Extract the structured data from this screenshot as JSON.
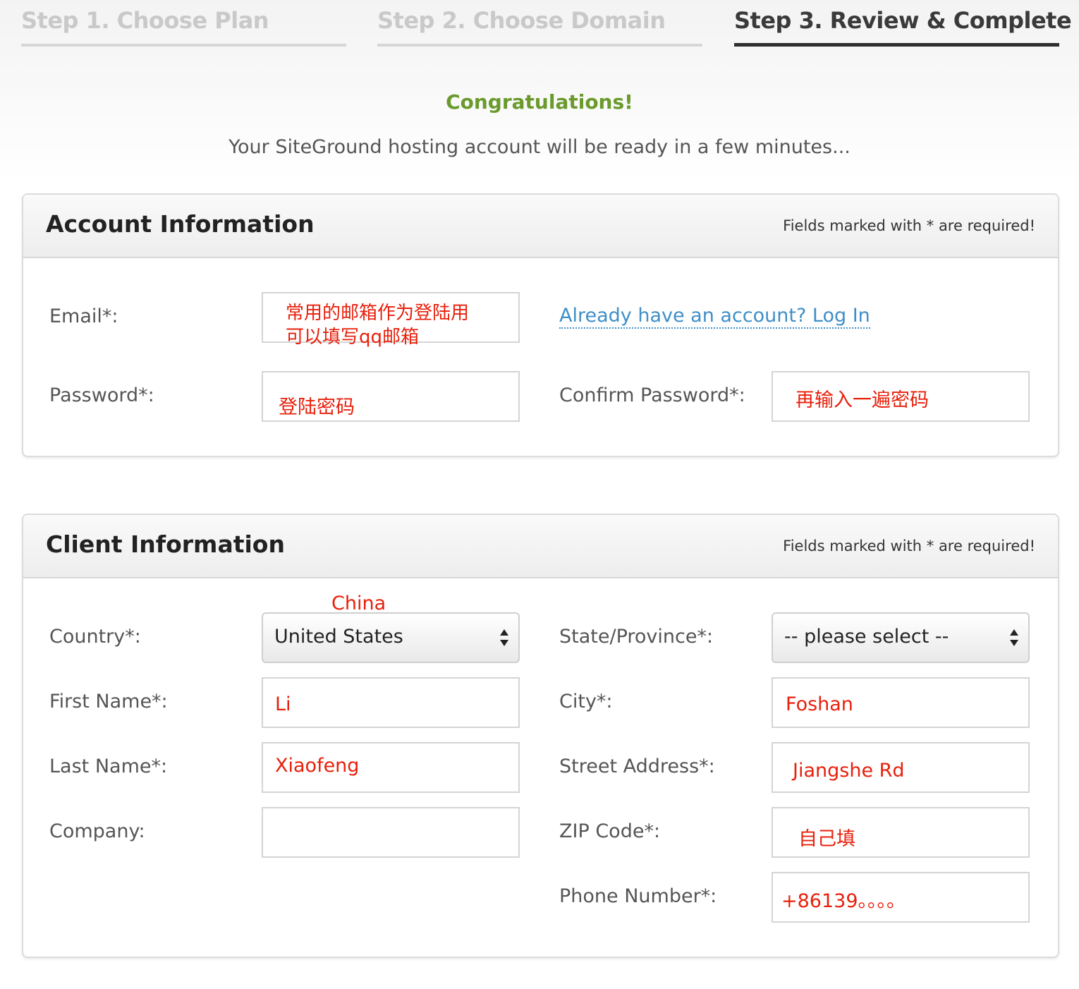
{
  "steps": [
    {
      "label": "Step 1. Choose Plan",
      "state": "inactive"
    },
    {
      "label": "Step 2. Choose Domain",
      "state": "inactive"
    },
    {
      "label": "Step 3. Review & Complete",
      "state": "active"
    }
  ],
  "congrats": "Congratulations!",
  "ready_text": "Your SiteGround hosting account will be ready in a few minutes...",
  "account": {
    "title": "Account Information",
    "note": "Fields marked with * are required!",
    "email_label": "Email*:",
    "email_annotation_line1": "常用的邮箱作为登陆用",
    "email_annotation_line2": "可以填写qq邮箱",
    "login_link": "Already have an account? Log In",
    "password_label": "Password*:",
    "password_annotation": "登陆密码",
    "confirm_label": "Confirm Password*:",
    "confirm_annotation": "再输入一遍密码"
  },
  "client": {
    "title": "Client Information",
    "note": "Fields marked with * are required!",
    "country_label": "Country*:",
    "country_value": "United States",
    "country_annotation": "China",
    "state_label": "State/Province*:",
    "state_value": "-- please select --",
    "first_name_label": "First Name*:",
    "first_name_annotation": "Li",
    "city_label": "City*:",
    "city_annotation": "Foshan",
    "last_name_label": "Last Name*:",
    "last_name_annotation": "Xiaofeng",
    "street_label": "Street Address*:",
    "street_annotation": "Jiangshe Rd",
    "company_label": "Company:",
    "zip_label": "ZIP Code*:",
    "zip_annotation": "自己填",
    "phone_label": "Phone Number*:",
    "phone_annotation": "+86139。。。。"
  },
  "colors": {
    "accent_green": "#6a9a2c",
    "link_blue": "#3f8fc8",
    "annotation_red": "#e8200c"
  }
}
